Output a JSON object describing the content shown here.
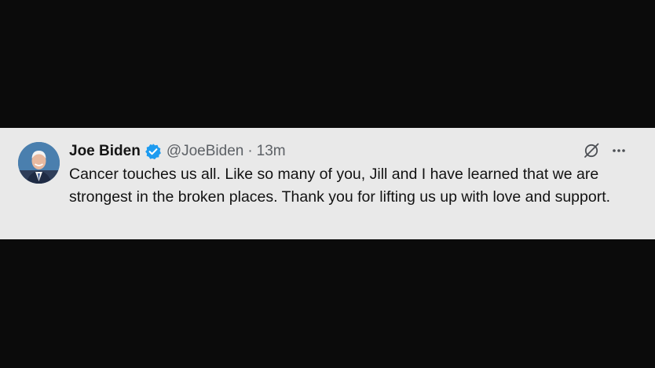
{
  "tweet": {
    "display_name": "Joe Biden",
    "handle": "@JoeBiden",
    "separator": "·",
    "time": "13m",
    "text": "Cancer touches us all. Like so many of you, Jill and I have learned that we are strongest in the broken places. Thank you for lifting us up with love and support."
  },
  "icons": {
    "verified": "verified-badge-icon",
    "grok": "grok-icon",
    "more": "more-options-icon"
  },
  "colors": {
    "card_background": "#e9e9e9",
    "page_background": "#0b0b0b",
    "verified_blue": "#1d9bf0",
    "muted_text": "#5d6166"
  }
}
